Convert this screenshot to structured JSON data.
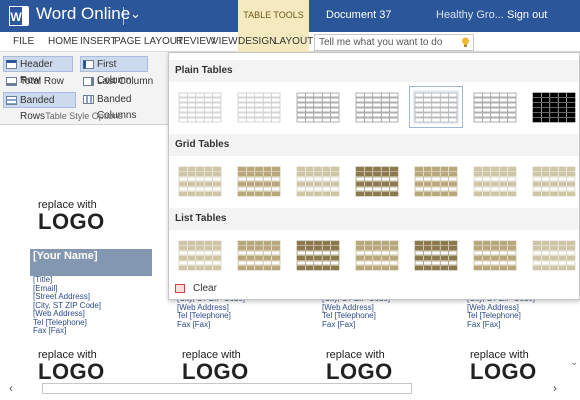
{
  "titlebar": {
    "app_icon_letter": "W",
    "app_name": "Word Online",
    "context_tab": "TABLE TOOLS",
    "document_name": "Document 37",
    "user_name": "Healthy Gro...",
    "sign_out": "Sign out"
  },
  "ribbon_tabs": [
    "FILE",
    "HOME",
    "INSERT",
    "PAGE LAYOUT",
    "REVIEW",
    "VIEW",
    "DESIGN",
    "LAYOUT"
  ],
  "tell_me": {
    "placeholder": "Tell me what you want to do"
  },
  "style_options": {
    "items": [
      {
        "label": "Header Row",
        "checked": true
      },
      {
        "label": "First Column",
        "checked": true
      },
      {
        "label": "Total Row",
        "checked": false
      },
      {
        "label": "Last Column",
        "checked": false
      },
      {
        "label": "Banded Rows",
        "checked": true
      },
      {
        "label": "Banded Columns",
        "checked": false
      }
    ],
    "group_label": "Table Style Options"
  },
  "gallery": {
    "sections": [
      {
        "title": "Plain Tables",
        "count": 7,
        "colors": [
          "#b9b9b9",
          "#b9b9b9",
          "#7a7a7a",
          "#7a7a7a",
          "#9a9a9a",
          "#7a7a7a",
          "#000000"
        ]
      },
      {
        "title": "Grid Tables",
        "count": 7,
        "colors": [
          "#cfc6a8",
          "#b8a87c",
          "#cfc6a8",
          "#8c7a4e",
          "#b8a87c",
          "#cfc6a8",
          "#cfc6a8"
        ]
      },
      {
        "title": "List Tables",
        "count": 7,
        "colors": [
          "#cfc6a8",
          "#b8a87c",
          "#8c7a4e",
          "#b8a87c",
          "#8c7a4e",
          "#b8a87c",
          "#cfc6a8"
        ]
      }
    ],
    "selected_index": 4,
    "clear_label": "Clear"
  },
  "document": {
    "logo_blocks": [
      {
        "replace": "replace with",
        "logo": "LOGO"
      },
      {
        "replace": "replace with",
        "logo": "LOGO"
      },
      {
        "replace": "replace with",
        "logo": "LOGO"
      },
      {
        "replace": "replace with",
        "logo": "LOGO"
      },
      {
        "replace": "replace with",
        "logo": "LOGO"
      }
    ],
    "name_placeholder": "[Your Name]",
    "address_lines": [
      "[Title]",
      "[Email]",
      "[Street Address]",
      "[City, ST  ZIP Code]",
      "[Web Address]",
      "Tel  [Telephone]",
      "Fax  [Fax]"
    ],
    "partial_address_lines": [
      "[City, ST  ZIP Code]",
      "[Web Address]",
      "Tel  [Telephone]",
      "Fax  [Fax]"
    ]
  },
  "colors": {
    "word_blue": "#2b579a",
    "table_tools_tab": "#f5e9bf",
    "name_box": "#8497b0",
    "address_text": "#2e4b8a"
  }
}
